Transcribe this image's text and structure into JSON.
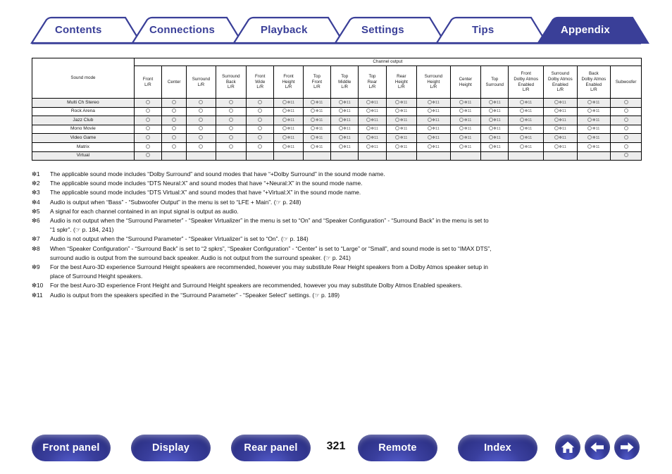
{
  "tabs": [
    {
      "label": "Contents",
      "active": false
    },
    {
      "label": "Connections",
      "active": false
    },
    {
      "label": "Playback",
      "active": false
    },
    {
      "label": "Settings",
      "active": false
    },
    {
      "label": "Tips",
      "active": false
    },
    {
      "label": "Appendix",
      "active": true
    }
  ],
  "table": {
    "group_header": "Channel output",
    "row_header": "Sound mode",
    "columns": [
      "Front\nL/R",
      "Center",
      "Surround\nL/R",
      "Surround\nBack\nL/R",
      "Front\nWide\nL/R",
      "Front\nHeight\nL/R",
      "Top\nFront\nL/R",
      "Top\nMiddle\nL/R",
      "Top\nRear\nL/R",
      "Rear\nHeight\nL/R",
      "Surround\nHeight\nL/R",
      "Center\nHeight",
      "Top\nSurround",
      "Front\nDolby Atmos\nEnabled\nL/R",
      "Surround\nDolby Atmos\nEnabled\nL/R",
      "Back\nDolby Atmos\nEnabled\nL/R",
      "Subwoofer"
    ],
    "rows": [
      {
        "mode": "Multi Ch Stereo",
        "cells": [
          "o",
          "o",
          "o",
          "o",
          "o",
          "o*11",
          "o*11",
          "o*11",
          "o*11",
          "o*11",
          "o*11",
          "o*11",
          "o*11",
          "o*11",
          "o*11",
          "o*11",
          "o"
        ]
      },
      {
        "mode": "Rock Arena",
        "cells": [
          "o",
          "o",
          "o",
          "o",
          "o",
          "o*11",
          "o*11",
          "o*11",
          "o*11",
          "o*11",
          "o*11",
          "o*11",
          "o*11",
          "o*11",
          "o*11",
          "o*11",
          "o"
        ]
      },
      {
        "mode": "Jazz Club",
        "cells": [
          "o",
          "o",
          "o",
          "o",
          "o",
          "o*11",
          "o*11",
          "o*11",
          "o*11",
          "o*11",
          "o*11",
          "o*11",
          "o*11",
          "o*11",
          "o*11",
          "o*11",
          "o"
        ]
      },
      {
        "mode": "Mono Movie",
        "cells": [
          "o",
          "o",
          "o",
          "o",
          "o",
          "o*11",
          "o*11",
          "o*11",
          "o*11",
          "o*11",
          "o*11",
          "o*11",
          "o*11",
          "o*11",
          "o*11",
          "o*11",
          "o"
        ]
      },
      {
        "mode": "Video Game",
        "cells": [
          "o",
          "o",
          "o",
          "o",
          "o",
          "o*11",
          "o*11",
          "o*11",
          "o*11",
          "o*11",
          "o*11",
          "o*11",
          "o*11",
          "o*11",
          "o*11",
          "o*11",
          "o"
        ]
      },
      {
        "mode": "Matrix",
        "cells": [
          "o",
          "o",
          "o",
          "o",
          "o",
          "o*11",
          "o*11",
          "o*11",
          "o*11",
          "o*11",
          "o*11",
          "o*11",
          "o*11",
          "o*11",
          "o*11",
          "o*11",
          "o"
        ]
      },
      {
        "mode": "Virtual",
        "cells": [
          "o",
          "",
          "",
          "",
          "",
          "",
          "",
          "",
          "",
          "",
          "",
          "",
          "",
          "",
          "",
          "",
          "o"
        ]
      }
    ]
  },
  "footnotes": [
    {
      "num": "✼1",
      "text": "The applicable sound mode includes “Dolby Surround” and sound modes that have “+Dolby Surround” in the sound mode name.",
      "cont": ""
    },
    {
      "num": "✼2",
      "text": "The applicable sound mode includes “DTS Neural:X” and sound modes that have “+Neural:X” in the sound mode name.",
      "cont": ""
    },
    {
      "num": "✼3",
      "text": "The applicable sound mode includes “DTS Virtual:X” and sound modes that have “+Virtual:X” in the sound mode name.",
      "cont": ""
    },
    {
      "num": "✼4",
      "text": "Audio is output when “Bass” - “Subwoofer Output” in the menu is set to “LFE + Main”.  (☞ p. 248)",
      "cont": ""
    },
    {
      "num": "✼5",
      "text": "A signal for each channel contained in an input signal is output as audio.",
      "cont": ""
    },
    {
      "num": "✼6",
      "text": "Audio is not output when the “Surround Parameter” - “Speaker Virtualizer” in the menu is set to “On” and “Speaker Configuration” - “Surround Back” in the menu is set to",
      "cont": "“1 spkr”. (☞ p. 184,  241)"
    },
    {
      "num": "✼7",
      "text": "Audio is not output when the “Surround Parameter” - “Speaker Virtualizer” is set to “On”.  (☞ p. 184)",
      "cont": ""
    },
    {
      "num": "✼8",
      "text": "When “Speaker Configuration” - “Surround Back” is set to “2 spkrs”, “Speaker Configuration” - “Center” is set to “Large” or “Small”, and sound mode is set to “IMAX DTS”,",
      "cont": "surround audio is output from the surround back speaker. Audio is not output from the surround speaker.  (☞ p. 241)"
    },
    {
      "num": "✼9",
      "text": "For the best Auro-3D experience Surround Height speakers are recommended, however you may substitute Rear Height speakers from a Dolby Atmos speaker setup in",
      "cont": "place of Surround Height speakers."
    },
    {
      "num": "✼10",
      "text": "For the best Auro-3D experience Front Height and Surround Height speakers are recommended, however you may substitute Dolby Atmos Enabled speakers.",
      "cont": ""
    },
    {
      "num": "✼11",
      "text": "Audio is output from the speakers specified in the “Surround Parameter” - “Speaker Select” settings.  (☞ p. 189)",
      "cont": ""
    }
  ],
  "bottom_nav": {
    "buttons": [
      {
        "label": "Front panel"
      },
      {
        "label": "Display"
      },
      {
        "label": "Rear panel"
      },
      {
        "label": "Remote"
      },
      {
        "label": "Index"
      }
    ],
    "page_number": "321",
    "icons": [
      "home-icon",
      "back-arrow-icon",
      "forward-arrow-icon"
    ]
  },
  "colors": {
    "brand_blue": "#3a3f98",
    "tab_active_fill": "#3a3f98",
    "row_alt": "#ededed"
  }
}
